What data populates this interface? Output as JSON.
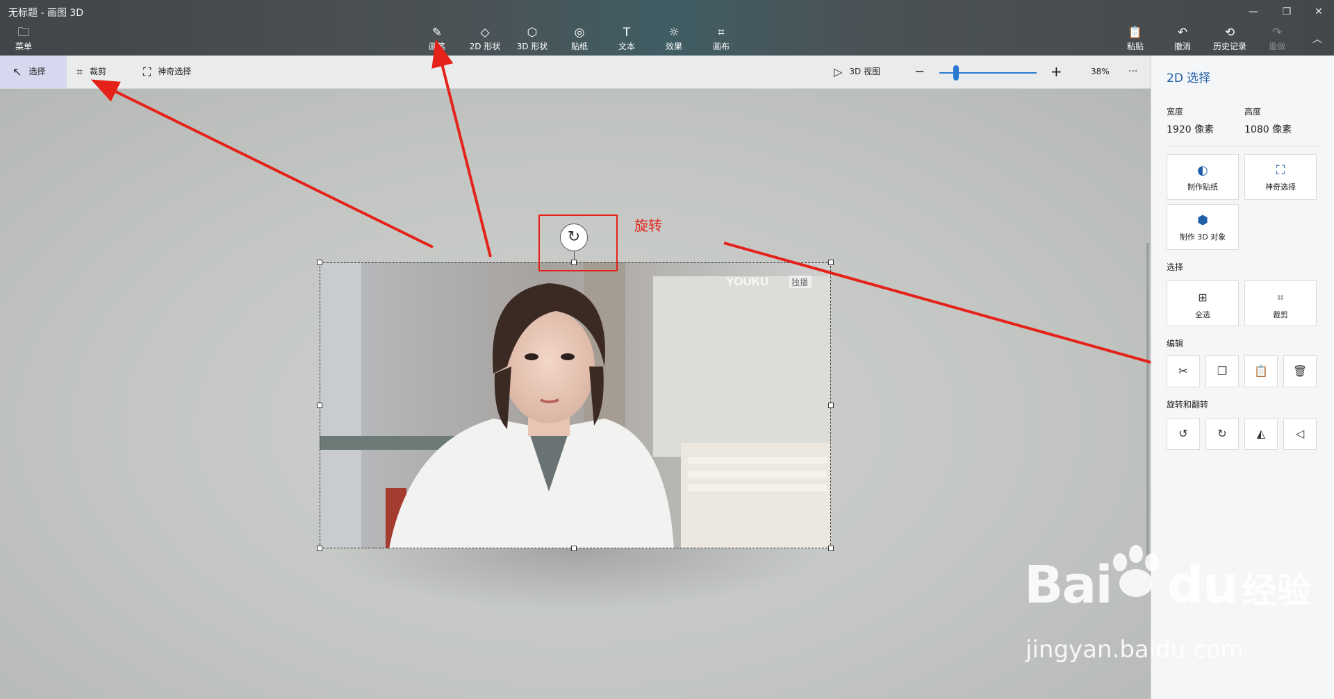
{
  "window": {
    "title": "无标题 - 画图 3D",
    "controls": {
      "minimize": "—",
      "restore": "❐",
      "close": "✕"
    }
  },
  "toolbar": {
    "menu": {
      "label": "菜单",
      "icon": "folder-icon"
    },
    "tools": [
      {
        "label": "画笔",
        "icon": "brush-icon"
      },
      {
        "label": "2D 形状",
        "icon": "2d-shapes-icon"
      },
      {
        "label": "3D 形状",
        "icon": "3d-shapes-icon"
      },
      {
        "label": "贴纸",
        "icon": "stickers-icon"
      },
      {
        "label": "文本",
        "icon": "text-icon"
      },
      {
        "label": "效果",
        "icon": "effects-icon"
      },
      {
        "label": "画布",
        "icon": "canvas-icon"
      }
    ],
    "right": [
      {
        "label": "粘贴",
        "icon": "paste-icon"
      },
      {
        "label": "撤消",
        "icon": "undo-icon"
      },
      {
        "label": "历史记录",
        "icon": "history-icon"
      },
      {
        "label": "重做",
        "icon": "redo-icon"
      }
    ],
    "collapse_icon": "chevron-up-icon"
  },
  "subbar": {
    "select": "选择",
    "crop": "裁剪",
    "magic_select": "神奇选择",
    "view3d": "3D 视图",
    "zoom_value": "38%",
    "zoom_level": 0.17,
    "more": "···"
  },
  "canvas": {
    "rotate_annotation": "旋转",
    "image_watermark": "YOUKU",
    "image_badge": "独播"
  },
  "panel": {
    "title": "2D 选择",
    "width_label": "宽度",
    "width_value": "1920 像素",
    "height_label": "高度",
    "height_value": "1080 像素",
    "make_sticker": "制作贴纸",
    "magic_select": "神奇选择",
    "make_3d": "制作 3D 对象",
    "select_section": "选择",
    "select_all": "全选",
    "crop": "裁剪",
    "edit_section": "编辑",
    "rotate_section": "旋转和翻转"
  },
  "watermark": {
    "brand": "Bai",
    "brand2": "du",
    "cn": "经验",
    "url": "jingyan.baidu.com"
  },
  "colors": {
    "accent": "#1f5fa8",
    "annotation_red": "#e5221a",
    "zoom_blue": "#2a7ad2"
  }
}
